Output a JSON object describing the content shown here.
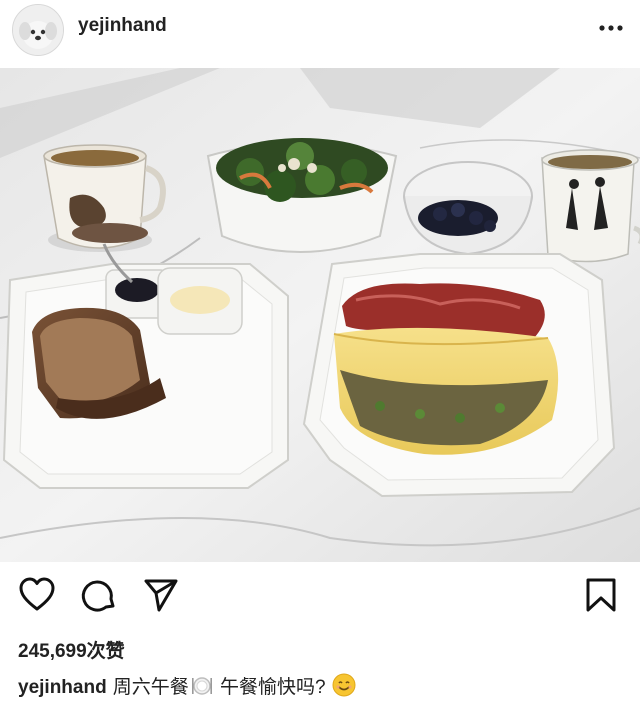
{
  "post": {
    "username": "yejinhand",
    "more_icon": "more-horizontal-icon",
    "avatar_icon": "dog-avatar",
    "photo_alt": "breakfast table with omelette, bacon, toast, salad and tea"
  },
  "actions": {
    "like_icon": "heart-icon",
    "comment_icon": "comment-icon",
    "share_icon": "send-icon",
    "save_icon": "bookmark-icon"
  },
  "likes": {
    "text": "245,699次赞"
  },
  "caption": {
    "username": "yejinhand",
    "text_part1": "周六午餐",
    "text_part2": "午餐愉快吗?",
    "emoji_plate": "plate-cutlery-emoji",
    "emoji_smile": "smiling-face-emoji"
  },
  "colors": {
    "text": "#222222",
    "background": "#ffffff"
  }
}
